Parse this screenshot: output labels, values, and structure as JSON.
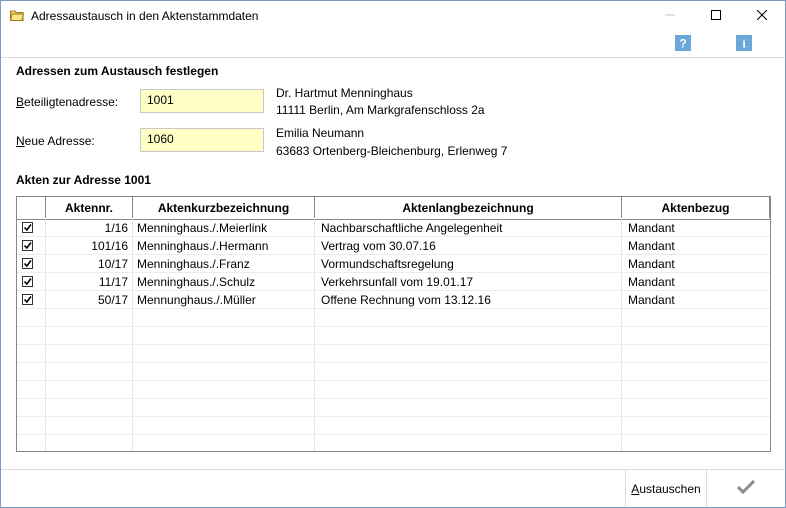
{
  "window": {
    "title": "Adressaustausch in den Aktenstammdaten",
    "help_icon_text": "?",
    "info_icon_text": "i"
  },
  "section_address": {
    "heading": "Adressen zum Austausch festlegen",
    "beteiligte_label_accel": "B",
    "beteiligte_label_rest": "eteiligtenadresse:",
    "beteiligte_value": "1001",
    "beteiligte_name": "Dr. Hartmut Menninghaus",
    "beteiligte_address": "11111 Berlin, Am Markgrafenschloss 2a",
    "neue_label_accel": "N",
    "neue_label_rest": "eue Adresse:",
    "neue_value": "1060",
    "neue_name": "Emilia Neumann",
    "neue_address": "63683 Ortenberg-Bleichenburg, Erlenweg 7"
  },
  "section_files": {
    "heading": "Akten zur Adresse 1001",
    "columns": [
      "Aktennr.",
      "Aktenkurzbezeichnung",
      "Aktenlangbezeichnung",
      "Aktenbezug"
    ],
    "rows": [
      {
        "checked": true,
        "nr": "1/16",
        "kurz": "Menninghaus./.Meierlink",
        "lang": "Nachbarschaftliche Angelegenheit",
        "bezug": "Mandant"
      },
      {
        "checked": true,
        "nr": "101/16",
        "kurz": "Menninghaus./.Hermann",
        "lang": "Vertrag vom 30.07.16",
        "bezug": "Mandant"
      },
      {
        "checked": true,
        "nr": "10/17",
        "kurz": "Menninghaus./.Franz",
        "lang": "Vormundschaftsregelung",
        "bezug": "Mandant"
      },
      {
        "checked": true,
        "nr": "11/17",
        "kurz": "Menninghaus./.Schulz",
        "lang": "Verkehrsunfall vom 19.01.17",
        "bezug": "Mandant"
      },
      {
        "checked": true,
        "nr": "50/17",
        "kurz": "Mennunghaus./.Müller",
        "lang": "Offene Rechnung vom 13.12.16",
        "bezug": "Mandant"
      }
    ]
  },
  "footer": {
    "exchange_label": "Austauschen",
    "exchange_accel": "A",
    "exchange_rest": "ustauschen"
  },
  "colors": {
    "field_bg": "#ffffc6",
    "help_icon_bg": "#6aa7d8",
    "checkmark_disabled": "#8c8c8c"
  }
}
